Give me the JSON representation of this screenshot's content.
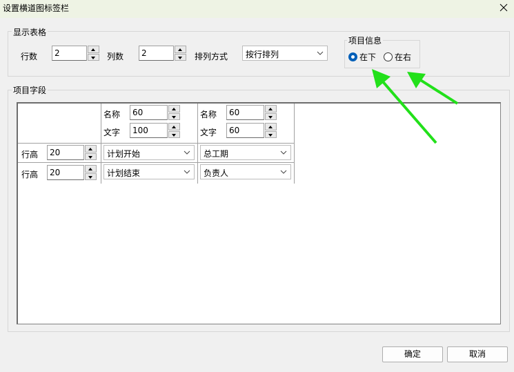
{
  "dialog": {
    "title": "设置横道图标签栏"
  },
  "display_group": {
    "label": "显示表格",
    "rows_label": "行数",
    "rows_value": "2",
    "cols_label": "列数",
    "cols_value": "2",
    "arrange_label": "排列方式",
    "arrange_value": "按行排列"
  },
  "info_group": {
    "label": "项目信息",
    "options": [
      "在下",
      "在右"
    ],
    "selected": "在下"
  },
  "fields_group": {
    "label": "项目字段",
    "header_cells": [
      {
        "name_label": "名称",
        "name_value": "60",
        "text_label": "文字",
        "text_value": "100"
      },
      {
        "name_label": "名称",
        "name_value": "60",
        "text_label": "文字",
        "text_value": "60"
      }
    ],
    "rows": [
      {
        "height_label": "行高",
        "height_value": "20",
        "cells": [
          "计划开始",
          "总工期"
        ]
      },
      {
        "height_label": "行高",
        "height_value": "20",
        "cells": [
          "计划结束",
          "负责人"
        ]
      }
    ]
  },
  "buttons": {
    "ok": "确定",
    "cancel": "取消"
  },
  "colors": {
    "annotation_arrow": "#22e01a",
    "accent": "#005fb8"
  }
}
